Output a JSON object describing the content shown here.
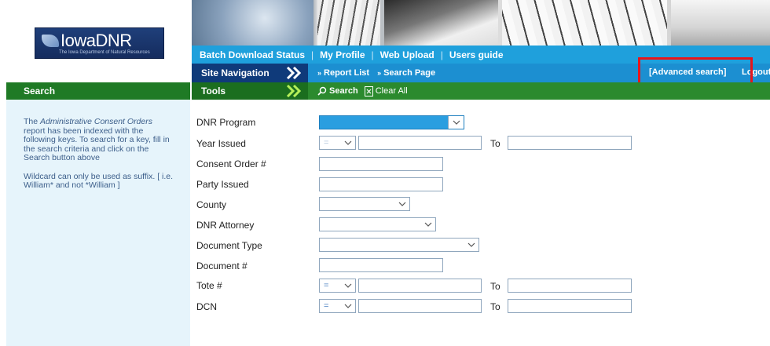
{
  "logo": {
    "title": "IowaDNR",
    "subtitle": "The Iowa Department of Natural Resources"
  },
  "top_nav": [
    "Batch Download Status",
    "My Profile",
    "Web Upload",
    "Users guide"
  ],
  "site_nav": {
    "label": "Site Navigation",
    "crumbs": [
      "Report List",
      "Search Page"
    ],
    "advanced_search": "[Advanced search]",
    "logout": "Logout"
  },
  "tools": {
    "left_title": "Search",
    "label": "Tools",
    "search": "Search",
    "clear_all": "Clear All"
  },
  "info": {
    "p1_prefix": "The ",
    "p1_italic": "Administrative Consent Orders",
    "p1_suffix": " report has been indexed with the following keys. To search for a key, fill in the search criteria and click on the Search button above",
    "p2": "Wildcard can only be used as suffix. [ i.e. William* and not *William ]"
  },
  "form": {
    "dnr_program": "DNR Program",
    "year_issued": "Year Issued",
    "consent_order": "Consent Order #",
    "party_issued": "Party Issued",
    "county": "County",
    "dnr_attorney": "DNR Attorney",
    "document_type": "Document Type",
    "document_num": "Document #",
    "tote": "Tote #",
    "dcn": "DCN",
    "to": "To",
    "op_year": "=",
    "op_tote": "=",
    "op_dcn": "="
  },
  "colors": {
    "highlight": "#e8151b",
    "nav_blue": "#1fa0dc",
    "green": "#2b8a2e",
    "navy": "#0f3a7a"
  }
}
